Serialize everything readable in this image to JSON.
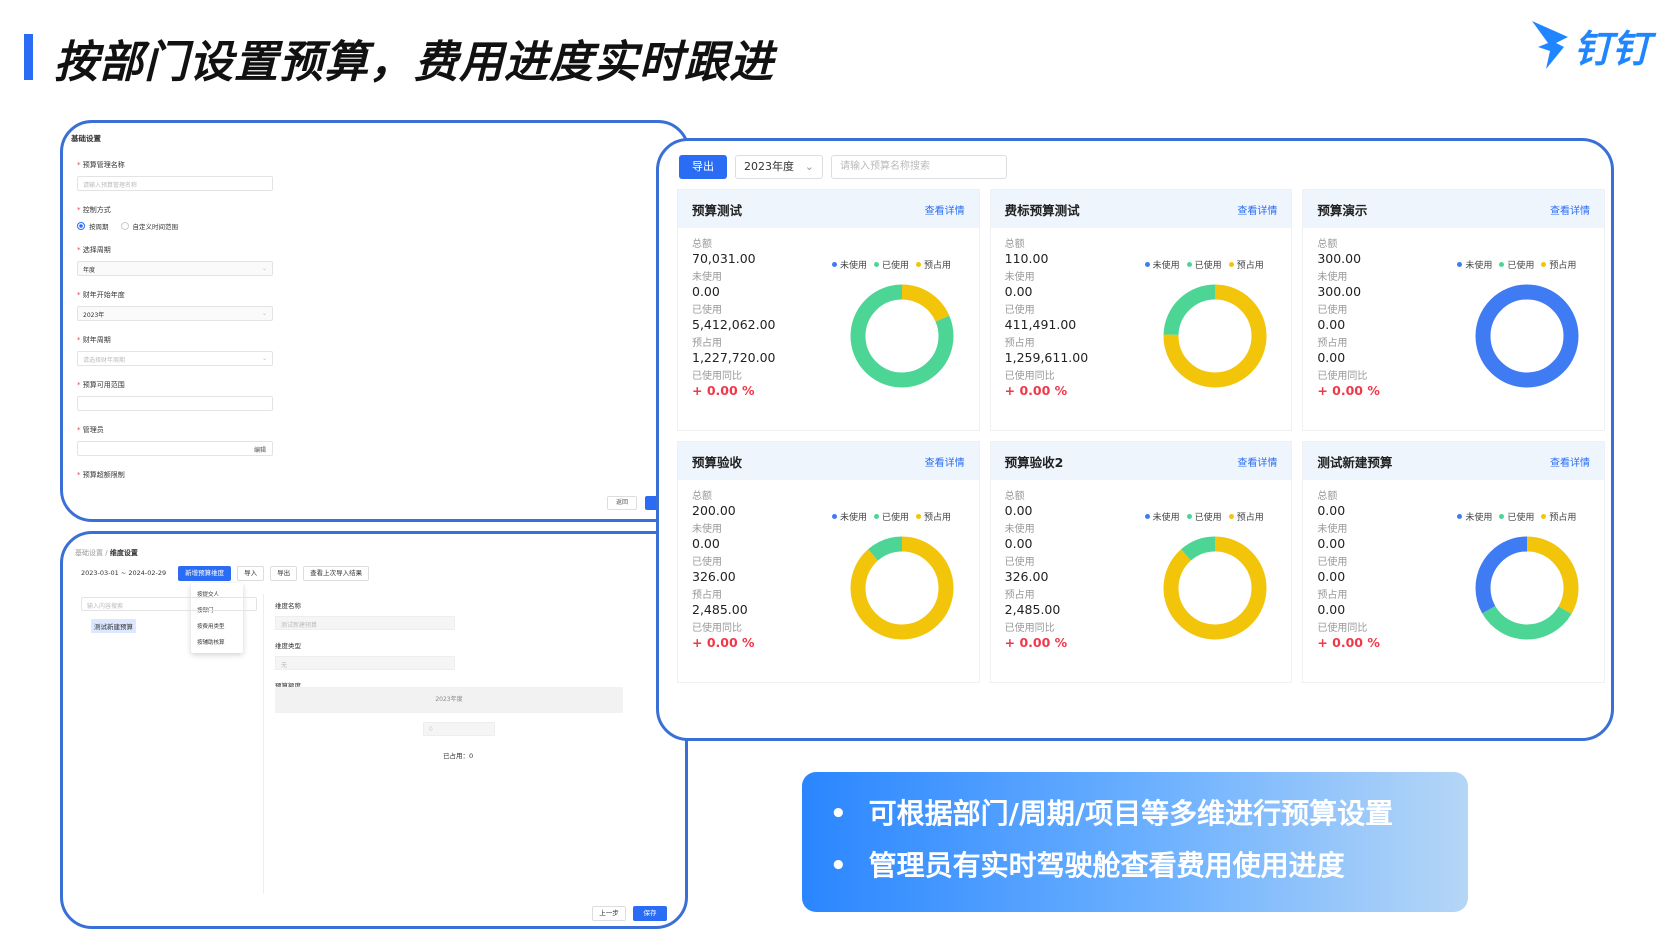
{
  "header": {
    "title": "按部门设置预算，费用进度实时跟进",
    "logo_text": "钉钉",
    "accent_color": "#2a6df4"
  },
  "basic_settings": {
    "section_title": "基础设置",
    "fields": {
      "budget_name_label": "预算管理名称",
      "budget_name_placeholder": "请输入预算管理名称",
      "control_method_label": "控制方式",
      "control_option_period": "按周期",
      "control_option_custom": "自定义时间范围",
      "period_label": "选择周期",
      "period_value": "年度",
      "fiscal_start_label": "财年开始年度",
      "fiscal_start_value": "2023年",
      "fiscal_period_label": "财年周期",
      "fiscal_period_placeholder": "请选择财年周期",
      "scope_label": "预算可用范围",
      "admin_label": "管理员",
      "admin_edit": "编辑",
      "overspend_label": "预算超额限制"
    },
    "back_button": "返回"
  },
  "dimension_settings": {
    "breadcrumb_parent": "基础设置",
    "breadcrumb_sep": "/",
    "breadcrumb_current": "维度设置",
    "date_range": "2023-03-01 ~ 2024-02-29",
    "add_dimension": "新增预算维度",
    "import": "导入",
    "export": "导出",
    "view_last_import": "查看上次导入结果",
    "dropdown_items": [
      "按提交人",
      "按部门",
      "按费用类型",
      "按辅助核算"
    ],
    "search_placeholder": "输入内容搜索",
    "tree_item": "测试新建预算",
    "dim_name_label": "维度名称",
    "dim_name_value": "测试新建预算",
    "dim_type_label": "维度类型",
    "dim_type_value": "无",
    "budget_amount_label": "预算额度",
    "year_label": "2023年度",
    "amount_value": "0",
    "occupied": "已占用：0",
    "prev_button": "上一步",
    "save_button": "保存"
  },
  "dashboard": {
    "export_button": "导出",
    "year_select": "2023年度",
    "search_placeholder": "请输入预算名称搜索",
    "detail_link": "查看详情",
    "labels": {
      "total": "总额",
      "unused": "未使用",
      "used": "已使用",
      "reserved": "预占用",
      "yoy": "已使用同比"
    },
    "legend": {
      "unused": "未使用",
      "used": "已使用",
      "reserved": "预占用"
    },
    "colors": {
      "unused": "#3f7bf2",
      "used": "#4dd596",
      "reserved": "#f2c40a"
    },
    "cards": [
      {
        "name": "预算测试",
        "total": "70,031.00",
        "unused": "0.00",
        "used": "5,412,062.00",
        "reserved": "1,227,720.00",
        "yoy": "+ 0.00 %",
        "donut": {
          "unused": 0,
          "used": 5412062,
          "reserved": 1227720
        }
      },
      {
        "name": "费标预算测试",
        "total": "110.00",
        "unused": "0.00",
        "used": "411,491.00",
        "reserved": "1,259,611.00",
        "yoy": "+ 0.00 %",
        "donut": {
          "unused": 0,
          "used": 411491,
          "reserved": 1259611
        }
      },
      {
        "name": "预算演示",
        "total": "300.00",
        "unused": "300.00",
        "used": "0.00",
        "reserved": "0.00",
        "yoy": "+ 0.00 %",
        "donut": {
          "unused": 300,
          "used": 0,
          "reserved": 0
        }
      },
      {
        "name": "预算验收",
        "total": "200.00",
        "unused": "0.00",
        "used": "326.00",
        "reserved": "2,485.00",
        "yoy": "+ 0.00 %",
        "donut": {
          "unused": 0,
          "used": 326,
          "reserved": 2485
        }
      },
      {
        "name": "预算验收2",
        "total": "0.00",
        "unused": "0.00",
        "used": "326.00",
        "reserved": "2,485.00",
        "yoy": "+ 0.00 %",
        "donut": {
          "unused": 0,
          "used": 326,
          "reserved": 2485
        }
      },
      {
        "name": "测试新建预算",
        "total": "0.00",
        "unused": "0.00",
        "used": "0.00",
        "reserved": "0.00",
        "yoy": "+ 0.00 %",
        "donut": {
          "unused": 1,
          "used": 1,
          "reserved": 1
        }
      }
    ]
  },
  "info_box": {
    "bullets": [
      "可根据部门/周期/项目等多维进行预算设置",
      "管理员有实时驾驶舱查看费用使用进度"
    ]
  }
}
